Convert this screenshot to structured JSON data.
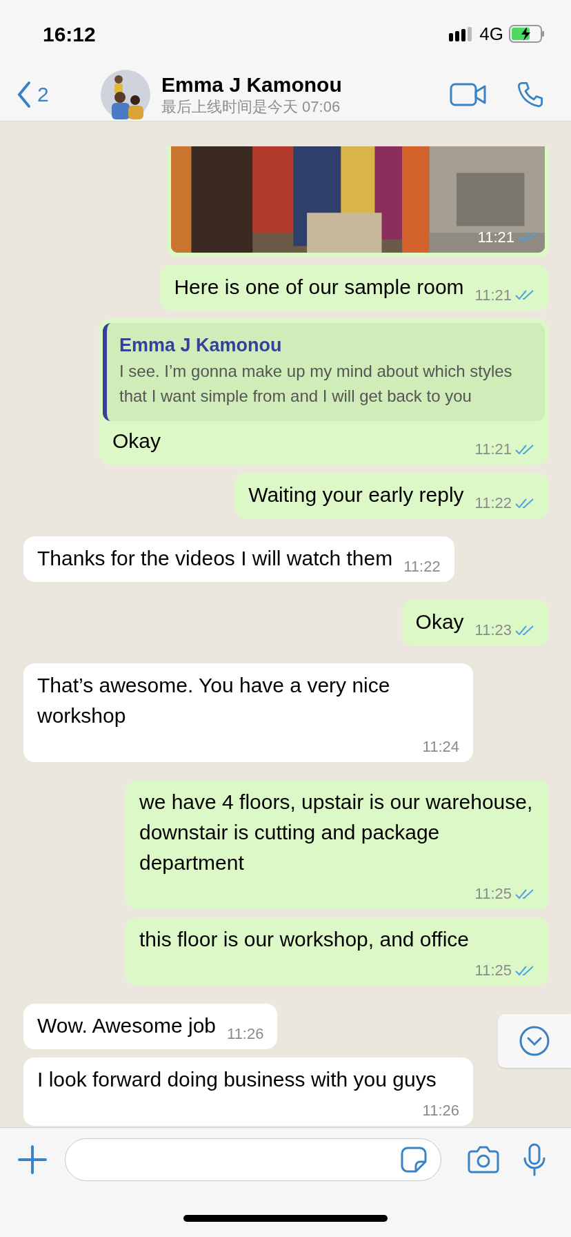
{
  "status_bar": {
    "time": "16:12",
    "network": "4G",
    "charging": true
  },
  "header": {
    "back_count": "2",
    "name": "Emma J Kamonou",
    "last_seen": "最后上线时间是今天 07:06"
  },
  "messages": [
    {
      "outgoing": true,
      "time": "11:21",
      "read": true
    },
    {
      "kind": "text",
      "outgoing": true,
      "text": "Here is one of our sample room",
      "time": "11:21",
      "read": true
    },
    {
      "kind": "reply",
      "outgoing": true,
      "quote_author": "Emma J Kamonou",
      "quote_text": "I see. I’m gonna make up my mind about which styles that I want simple from and I will get back to you",
      "text": "Okay",
      "time": "11:21",
      "read": true
    },
    {
      "kind": "text",
      "outgoing": true,
      "text": "Waiting your early reply",
      "time": "11:22",
      "read": true
    },
    {
      "kind": "text",
      "outgoing": false,
      "text": "Thanks for the videos I will watch them",
      "time": "11:22"
    },
    {
      "kind": "text",
      "outgoing": true,
      "text": "Okay",
      "time": "11:23",
      "read": true
    },
    {
      "kind": "text",
      "outgoing": false,
      "text": "That’s awesome. You have a very nice workshop",
      "time": "11:24"
    },
    {
      "kind": "text",
      "outgoing": true,
      "text": "we have 4 floors, upstair is our warehouse, downstair is cutting and package department",
      "time": "11:25",
      "read": true
    },
    {
      "kind": "text",
      "outgoing": true,
      "text": "this floor is our workshop, and office",
      "time": "11:25",
      "read": true
    },
    {
      "kind": "text",
      "outgoing": false,
      "text": "Wow. Awesome job",
      "time": "11:26"
    },
    {
      "kind": "text",
      "outgoing": false,
      "text": "I look forward doing business with you guys",
      "time": "11:26"
    }
  ]
}
